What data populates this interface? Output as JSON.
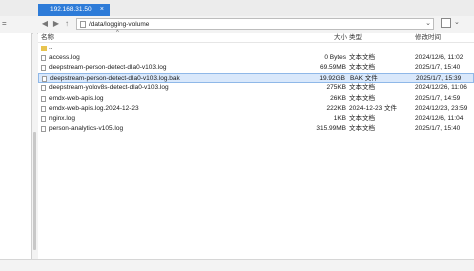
{
  "tab": {
    "title": "192.168.31.50",
    "close": "×"
  },
  "toolbar": {
    "left_hint": "=",
    "back": "◀",
    "forward": "▶",
    "up": "↑",
    "address": "/data/logging-volume",
    "dropdown": "⌄"
  },
  "columns": {
    "name": "名称",
    "size": "大小",
    "type": "类型",
    "date": "修改时间",
    "sort_indicator": "^"
  },
  "files": [
    {
      "name": "..",
      "size": "",
      "type": "",
      "date": "",
      "folder": true
    },
    {
      "name": "access.log",
      "size": "0 Bytes",
      "type": "文本文档",
      "date": "2024/12/6, 11:02"
    },
    {
      "name": "deepstream-person-detect-dla0-v103.log",
      "size": "69.59MB",
      "type": "文本文档",
      "date": "2025/1/7, 15:40"
    },
    {
      "name": "deepstream-person-detect-dla0-v103.log.bak",
      "size": "19.92GB",
      "type": "BAK 文件",
      "date": "2025/1/7, 15:39",
      "selected": true
    },
    {
      "name": "deepstream-yolov8s-detect-dla0-v103.log",
      "size": "275KB",
      "type": "文本文档",
      "date": "2024/12/26, 11:06"
    },
    {
      "name": "emdx-web-apis.log",
      "size": "26KB",
      "type": "文本文档",
      "date": "2025/1/7, 14:59"
    },
    {
      "name": "emdx-web-apis.log.2024-12-23",
      "size": "222KB",
      "type": "2024-12-23 文件",
      "date": "2024/12/23, 23:59"
    },
    {
      "name": "nginx.log",
      "size": "1KB",
      "type": "文本文档",
      "date": "2024/12/6, 11:04"
    },
    {
      "name": "person-analytics-v105.log",
      "size": "315.99MB",
      "type": "文本文档",
      "date": "2025/1/7, 15:40"
    }
  ]
}
